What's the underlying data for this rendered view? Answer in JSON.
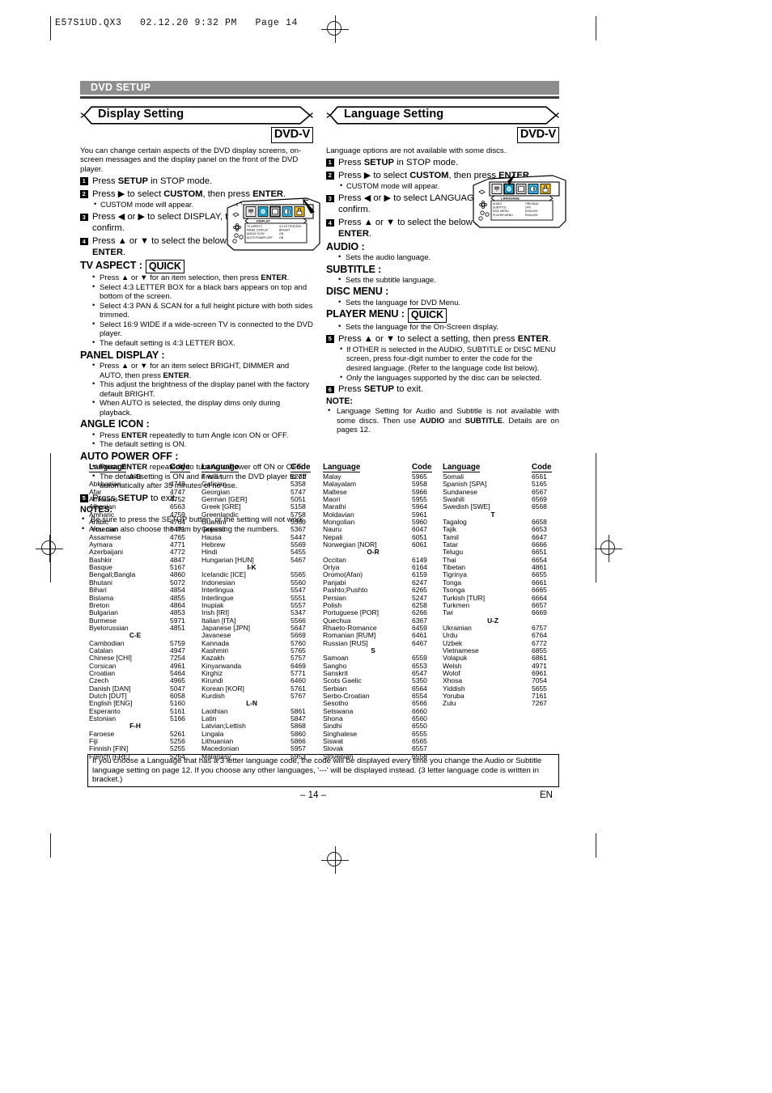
{
  "print_header": "E57S1UD.QX3   02.12.20 9:32 PM   Page 14",
  "section_banner": "DVD SETUP",
  "left": {
    "title": "Display Setting",
    "disc_badge": "DVD-V",
    "intro": "You can change certain aspects of the DVD display screens, on-screen messages and the display panel on the front of the DVD player.",
    "steps": [
      {
        "num": "1",
        "text": "Press <b>SETUP</b> in STOP mode."
      },
      {
        "num": "2",
        "text": "Press ▶ to select <b>CUSTOM</b>, then press <b>ENTER</b>."
      },
      {
        "num": "3",
        "text": "Press ◀ or ▶ to select DISPLAY, then <b>ENTER</b> to confirm."
      },
      {
        "num": "4",
        "text": "Press ▲ or ▼ to select the below items, then press <b>ENTER</b>."
      }
    ],
    "step2_sub": "CUSTOM mode will appear.",
    "items": [
      {
        "head": "TV ASPECT :",
        "quick": "QUICK",
        "bullets": [
          "Press ▲ or ▼ for an item selection, then press <b>ENTER</b>.",
          "Select 4:3 LETTER BOX for a black bars appears on top and bottom of the screen.",
          "Select 4:3 PAN &amp; SCAN for a full height picture with both sides trimmed.",
          "Select 16:9 WIDE if a wide-screen TV is connected to the DVD player.",
          "The default setting is 4:3 LETTER BOX."
        ]
      },
      {
        "head": "PANEL DISPLAY :",
        "quick": "",
        "bullets": [
          "Press ▲ or ▼ for an item select BRIGHT, DIMMER and AUTO, then press <b>ENTER</b>.",
          "This adjust the brightness of the display panel with the factory default BRIGHT.",
          "When AUTO is selected, the display dims only during playback."
        ]
      },
      {
        "head": "ANGLE ICON :",
        "quick": "",
        "bullets": [
          "Press <b>ENTER</b> repeatedly to turn Angle icon ON or OFF.",
          "The default setting is ON."
        ]
      },
      {
        "head": "AUTO POWER OFF :",
        "quick": "",
        "bullets": [
          "Press <b>ENTER</b> repeatedly to turn Auto Power off ON or OFF.",
          "The default setting is ON and it will turn the DVD player to off automatically after 35 minutes of no use."
        ]
      }
    ],
    "final_step": {
      "num": "5",
      "text": "Press <b>SETUP</b> to exit."
    },
    "notes_heading": "NOTES:",
    "notes": [
      "Be sure to press the SETUP button, or the setting will not work.",
      "You can also choose the item by pressing the numbers."
    ],
    "osd": {
      "title": "DISPLAY",
      "rows": [
        {
          "label": "TV ASPECT",
          "value": "4:3 LETTER BOX"
        },
        {
          "label": "PANEL DISPLAY",
          "value": "BRIGHT"
        },
        {
          "label": "ANGLE ICON",
          "value": "ON"
        },
        {
          "label": "AUTO POWER OFF",
          "value": "ON"
        }
      ],
      "selected_tab": 2
    }
  },
  "right": {
    "title": "Language Setting",
    "disc_badge": "DVD-V",
    "intro": "Language options are not available with some discs.",
    "steps": [
      {
        "num": "1",
        "text": "Press <b>SETUP</b> in STOP mode."
      },
      {
        "num": "2",
        "text": "Press ▶ to select <b>CUSTOM</b>, then press <b>ENTER</b>."
      },
      {
        "num": "3",
        "text": "Press ◀ or ▶ to select LANGUAGE, then <b>ENTER</b> to confirm."
      },
      {
        "num": "4",
        "text": "Press ▲ or ▼ to select the below items, then press <b>ENTER</b>."
      }
    ],
    "step2_sub": "CUSTOM mode will appear.",
    "items": [
      {
        "head": "AUDIO :",
        "quick": "",
        "bullets": [
          "Sets the audio language."
        ]
      },
      {
        "head": "SUBTITLE :",
        "quick": "",
        "bullets": [
          "Sets the subtitle language."
        ]
      },
      {
        "head": "DISC MENU :",
        "quick": "",
        "bullets": [
          "Sets the language for DVD Menu."
        ]
      },
      {
        "head": "PLAYER MENU :",
        "quick": "QUICK",
        "bullets": [
          "Sets the language for the On-Screen display."
        ]
      }
    ],
    "step5": {
      "num": "5",
      "text": "Press ▲ or ▼ to select a setting, then press <b>ENTER</b>."
    },
    "step5_subs": [
      "If OTHER is selected in the AUDIO, SUBTITLE or DISC MENU screen, press four-digit number to enter the code for the desired language. (Refer to the language code list below).",
      "Only the languages supported by the disc can be selected."
    ],
    "final_step": {
      "num": "6",
      "text": "Press <b>SETUP</b> to exit."
    },
    "notes_heading": "NOTE:",
    "notes": [
      "Language Setting for Audio and Subtitle is not available with some discs. Then use <b>AUDIO</b> and <b>SUBTITLE</b>. Details are on pages 12."
    ],
    "osd": {
      "title": "LANGUAGE",
      "rows": [
        {
          "label": "AUDIO",
          "value": "ORIGINAL"
        },
        {
          "label": "SUBTITLE",
          "value": "OFF"
        },
        {
          "label": "DISC MENU",
          "value": "ENGLISH"
        },
        {
          "label": "PLAYER MENU",
          "value": "ENGLISH"
        }
      ],
      "selected_tab": 1
    }
  },
  "language_table": {
    "header_language": "Language",
    "header_code": "Code",
    "columns": [
      {
        "rows": [
          {
            "group": "A-B"
          },
          {
            "name": "Abkhazian",
            "code": "4748"
          },
          {
            "name": "Afar",
            "code": "4747"
          },
          {
            "name": "Afrikaans",
            "code": "4752"
          },
          {
            "name": "Albanian",
            "code": "6563"
          },
          {
            "name": "Amharic",
            "code": "4759"
          },
          {
            "name": "Arabic",
            "code": "4764"
          },
          {
            "name": "Armenian",
            "code": "5471"
          },
          {
            "name": "Assamese",
            "code": "4765"
          },
          {
            "name": "Aymara",
            "code": "4771"
          },
          {
            "name": "Azerbaijani",
            "code": "4772"
          },
          {
            "name": "Bashkir",
            "code": "4847"
          },
          {
            "name": "Basque",
            "code": "5167"
          },
          {
            "name": "Bengali;Bangla",
            "code": "4860"
          },
          {
            "name": "Bhutani",
            "code": "5072"
          },
          {
            "name": "Bihari",
            "code": "4854"
          },
          {
            "name": "Bislama",
            "code": "4855"
          },
          {
            "name": "Breton",
            "code": "4864"
          },
          {
            "name": "Bulgarian",
            "code": "4853"
          },
          {
            "name": "Burmese",
            "code": "5971"
          },
          {
            "name": "Byelorussian",
            "code": "4851"
          },
          {
            "group": "C-E"
          },
          {
            "name": "Cambodian",
            "code": "5759"
          },
          {
            "name": "Catalan",
            "code": "4947"
          },
          {
            "name": "Chinese [CHI]",
            "code": "7254"
          },
          {
            "name": "Corsican",
            "code": "4961"
          },
          {
            "name": "Croatian",
            "code": "5464"
          },
          {
            "name": "Czech",
            "code": "4965"
          },
          {
            "name": "Danish [DAN]",
            "code": "5047"
          },
          {
            "name": "Dutch [DUT]",
            "code": "6058"
          },
          {
            "name": "English [ENG]",
            "code": "5160"
          },
          {
            "name": "Esperanto",
            "code": "5161"
          },
          {
            "name": "Estonian",
            "code": "5166"
          },
          {
            "group": "F-H"
          },
          {
            "name": "Faroese",
            "code": "5261"
          },
          {
            "name": "Fiji",
            "code": "5256"
          },
          {
            "name": "Finnish [FIN]",
            "code": "5255"
          },
          {
            "name": "French [FRE]",
            "code": "5264"
          }
        ]
      },
      {
        "rows": [
          {
            "name": "Frisian",
            "code": "5271"
          },
          {
            "name": "Galician",
            "code": "5358"
          },
          {
            "name": "Georgian",
            "code": "5747"
          },
          {
            "name": "German [GER]",
            "code": "5051"
          },
          {
            "name": "Greek [GRE]",
            "code": "5158"
          },
          {
            "name": "Greenlandic",
            "code": "5758"
          },
          {
            "name": "Guarani",
            "code": "5360"
          },
          {
            "name": "Gujarati",
            "code": "5367"
          },
          {
            "name": "Hausa",
            "code": "5447"
          },
          {
            "name": "Hebrew",
            "code": "5569"
          },
          {
            "name": "Hindi",
            "code": "5455"
          },
          {
            "name": "Hungarian [HUN]",
            "code": "5467"
          },
          {
            "group": "I-K"
          },
          {
            "name": "Icelandic [ICE]",
            "code": "5565"
          },
          {
            "name": "Indonesian",
            "code": "5560"
          },
          {
            "name": "Interlingua",
            "code": "5547"
          },
          {
            "name": "Interlingue",
            "code": "5551"
          },
          {
            "name": "Inupiak",
            "code": "5557"
          },
          {
            "name": "Irish [IRI]",
            "code": "5347"
          },
          {
            "name": "Italian [ITA]",
            "code": "5566"
          },
          {
            "name": "Japanese [JPN]",
            "code": "5647"
          },
          {
            "name": "Javanese",
            "code": "5669"
          },
          {
            "name": "Kannada",
            "code": "5760"
          },
          {
            "name": "Kashmiri",
            "code": "5765"
          },
          {
            "name": "Kazakh",
            "code": "5757"
          },
          {
            "name": "Kinyarwanda",
            "code": "6469"
          },
          {
            "name": "Kirghiz",
            "code": "5771"
          },
          {
            "name": "Kirundi",
            "code": "6460"
          },
          {
            "name": "Korean [KOR]",
            "code": "5761"
          },
          {
            "name": "Kurdish",
            "code": "5767"
          },
          {
            "group": "L-N"
          },
          {
            "name": "Laothian",
            "code": "5861"
          },
          {
            "name": "Latin",
            "code": "5847"
          },
          {
            "name": "Latvian;Lettish",
            "code": "5868"
          },
          {
            "name": "Lingala",
            "code": "5860"
          },
          {
            "name": "Lithuanian",
            "code": "5866"
          },
          {
            "name": "Macedonian",
            "code": "5957"
          },
          {
            "name": "Malagasy",
            "code": "5953"
          }
        ]
      },
      {
        "rows": [
          {
            "name": "Malay",
            "code": "5965"
          },
          {
            "name": "Malayalam",
            "code": "5958"
          },
          {
            "name": "Maltese",
            "code": "5966"
          },
          {
            "name": "Maori",
            "code": "5955"
          },
          {
            "name": "Marathi",
            "code": "5964"
          },
          {
            "name": "Moldavian",
            "code": "5961"
          },
          {
            "name": "Mongolian",
            "code": "5960"
          },
          {
            "name": "Nauru",
            "code": "6047"
          },
          {
            "name": "Nepali",
            "code": "6051"
          },
          {
            "name": "Norwegian [NOR]",
            "code": "6061"
          },
          {
            "group": "O-R"
          },
          {
            "name": "Occitan",
            "code": "6149"
          },
          {
            "name": "Oriya",
            "code": "6164"
          },
          {
            "name": "Oromo(Afan)",
            "code": "6159"
          },
          {
            "name": "Panjabi",
            "code": "6247"
          },
          {
            "name": "Pashto;Pushto",
            "code": "6265"
          },
          {
            "name": "Persian",
            "code": "5247"
          },
          {
            "name": "Polish",
            "code": "6258"
          },
          {
            "name": "Portuguese [POR]",
            "code": "6266"
          },
          {
            "name": "Quechua",
            "code": "6367"
          },
          {
            "name": "Rhaeto-Romance",
            "code": "6459"
          },
          {
            "name": "Romanian [RUM]",
            "code": "6461"
          },
          {
            "name": "Russian [RUS]",
            "code": "6467"
          },
          {
            "group": "S"
          },
          {
            "name": "Samoan",
            "code": "6559"
          },
          {
            "name": "Sangho",
            "code": "6553"
          },
          {
            "name": "Sanskrit",
            "code": "6547"
          },
          {
            "name": "Scots Gaelic",
            "code": "5350"
          },
          {
            "name": "Serbian",
            "code": "6564"
          },
          {
            "name": "Serbo-Croatian",
            "code": "6554"
          },
          {
            "name": "Sesotho",
            "code": "6566"
          },
          {
            "name": "Setswana",
            "code": "6660"
          },
          {
            "name": "Shona",
            "code": "6560"
          },
          {
            "name": "Sindhi",
            "code": "6550"
          },
          {
            "name": "Singhalese",
            "code": "6555"
          },
          {
            "name": "Siswat",
            "code": "6565"
          },
          {
            "name": "Slovak",
            "code": "6557"
          },
          {
            "name": "Slovenian",
            "code": "6558"
          }
        ]
      },
      {
        "rows": [
          {
            "name": "Somali",
            "code": "6561"
          },
          {
            "name": "Spanish [SPA]",
            "code": "5165"
          },
          {
            "name": "Sundanese",
            "code": "6567"
          },
          {
            "name": "Swahili",
            "code": "6569"
          },
          {
            "name": "Swedish [SWE]",
            "code": "6568"
          },
          {
            "group": "T"
          },
          {
            "name": "Tagalog",
            "code": "6658"
          },
          {
            "name": "Tajik",
            "code": "6653"
          },
          {
            "name": "Tamil",
            "code": "6647"
          },
          {
            "name": "Tatar",
            "code": "6666"
          },
          {
            "name": "Telugu",
            "code": "6651"
          },
          {
            "name": "Thai",
            "code": "6654"
          },
          {
            "name": "Tibetan",
            "code": "4861"
          },
          {
            "name": "Tigrinya",
            "code": "6655"
          },
          {
            "name": "Tonga",
            "code": "6661"
          },
          {
            "name": "Tsonga",
            "code": "6665"
          },
          {
            "name": "Turkish [TUR]",
            "code": "6664"
          },
          {
            "name": "Turkmen",
            "code": "6657"
          },
          {
            "name": "Twi",
            "code": "6669"
          },
          {
            "group": "U-Z"
          },
          {
            "name": "Ukrainian",
            "code": "6757"
          },
          {
            "name": "Urdu",
            "code": "6764"
          },
          {
            "name": "Uzbek",
            "code": "6772"
          },
          {
            "name": "Vietnamese",
            "code": "6855"
          },
          {
            "name": "Volapuk",
            "code": "6861"
          },
          {
            "name": "Welsh",
            "code": "4971"
          },
          {
            "name": "Wolof",
            "code": "6961"
          },
          {
            "name": "Xhosa",
            "code": "7054"
          },
          {
            "name": "Yiddish",
            "code": "5655"
          },
          {
            "name": "Yoruba",
            "code": "7161"
          },
          {
            "name": "Zulu",
            "code": "7267"
          }
        ]
      }
    ]
  },
  "footer_note": "If you choose a Language that has a 3 letter language code, the code will be displayed every time you change the Audio or Subtitle language setting on page 12. If you choose any other languages, '---' will be displayed instead. (3 letter language code is written in bracket.)",
  "page_number": "– 14 –",
  "lang_mark": "EN"
}
